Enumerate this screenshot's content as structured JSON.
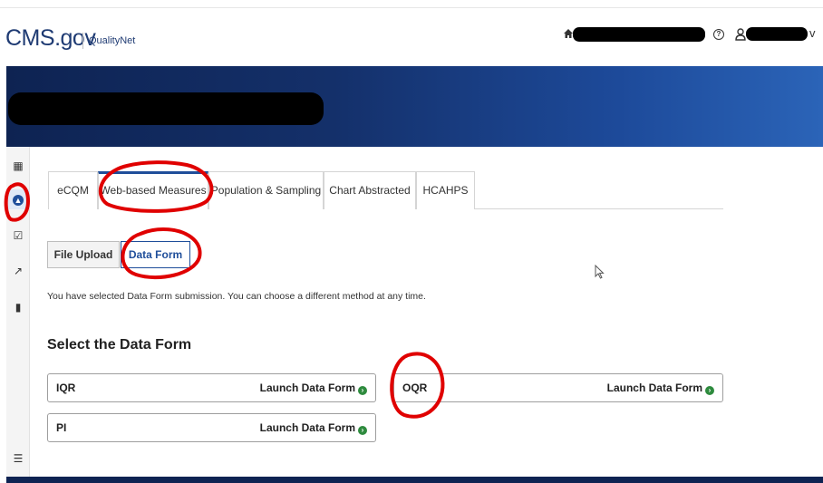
{
  "header": {
    "logo_main": "CMS",
    "logo_tld": ".gov",
    "sub_brand": "QualityNet",
    "home_icon": "home-icon",
    "help_icon": "help-icon",
    "user_icon": "user-icon",
    "menu_chevron": "v"
  },
  "sidebar": {
    "items": [
      {
        "icon": "grid-icon",
        "glyph": "▦"
      },
      {
        "icon": "upload-icon",
        "glyph": "▲"
      },
      {
        "icon": "checkbox-icon",
        "glyph": "☑"
      },
      {
        "icon": "chart-icon",
        "glyph": "↗"
      },
      {
        "icon": "clipboard-icon",
        "glyph": "▮"
      },
      {
        "icon": "collapse-icon",
        "glyph": "☰"
      }
    ]
  },
  "tabs": [
    {
      "label": "eCQM"
    },
    {
      "label": "Web-based Measures"
    },
    {
      "label": "Population & Sampling"
    },
    {
      "label": "Chart Abstracted"
    },
    {
      "label": "HCAHPS"
    }
  ],
  "methods": {
    "file_upload": "File Upload",
    "data_form": "Data Form"
  },
  "info_text": "You have selected Data Form submission. You can choose a different method at any time.",
  "section_title": "Select the Data Form",
  "forms": [
    {
      "name": "IQR",
      "action": "Launch Data Form"
    },
    {
      "name": "OQR",
      "action": "Launch Data Form"
    },
    {
      "name": "PI",
      "action": "Launch Data Form"
    }
  ],
  "colors": {
    "brand_navy": "#1f3b73",
    "accent_blue": "#1f4e9a",
    "launch_green": "#2e8b3e",
    "annotation_red": "#e00000"
  }
}
